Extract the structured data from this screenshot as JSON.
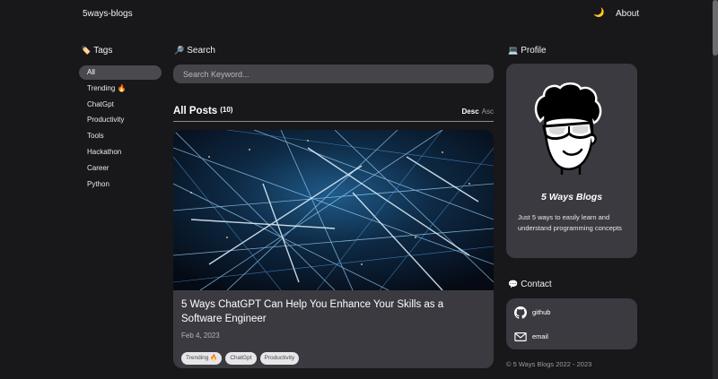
{
  "header": {
    "brand": "5ways-blogs",
    "theme_icon": "moon-icon",
    "about": "About"
  },
  "tags_section": {
    "title": "Tags",
    "icon": "tag-icon",
    "items": [
      {
        "label": "All",
        "active": true
      },
      {
        "label": "Trending 🔥",
        "active": false
      },
      {
        "label": "ChatGpt",
        "active": false
      },
      {
        "label": "Productivity",
        "active": false
      },
      {
        "label": "Tools",
        "active": false
      },
      {
        "label": "Hackathon",
        "active": false
      },
      {
        "label": "Career",
        "active": false
      },
      {
        "label": "Python",
        "active": false
      }
    ]
  },
  "search": {
    "title": "Search",
    "icon": "magnifier-icon",
    "placeholder": "Search Keyword..."
  },
  "posts": {
    "title": "All Posts",
    "count": "(10)",
    "sort_desc": "Desc",
    "sort_asc": "Asc",
    "items": [
      {
        "title": "5 Ways ChatGPT Can Help You Enhance Your Skills as a Software Engineer",
        "date": "Feb 4, 2023",
        "tags": [
          "Trending 🔥",
          "ChatGpt",
          "Productivity"
        ]
      }
    ]
  },
  "profile": {
    "title": "Profile",
    "icon": "laptop-icon",
    "name": "5 Ways Blogs",
    "description": "Just 5 ways to easily learn and understand programming concepts"
  },
  "contact": {
    "title": "Contact",
    "icon": "speech-bubble-icon",
    "items": [
      {
        "label": "github",
        "icon": "github-icon"
      },
      {
        "label": "email",
        "icon": "mail-icon"
      }
    ]
  },
  "footer": "© 5 Ways Blogs 2022 - 2023",
  "colors": {
    "background": "#18171a",
    "card": "#3b3a40",
    "input": "#454449",
    "active_tag": "#4a494f",
    "text": "#ffffff"
  }
}
